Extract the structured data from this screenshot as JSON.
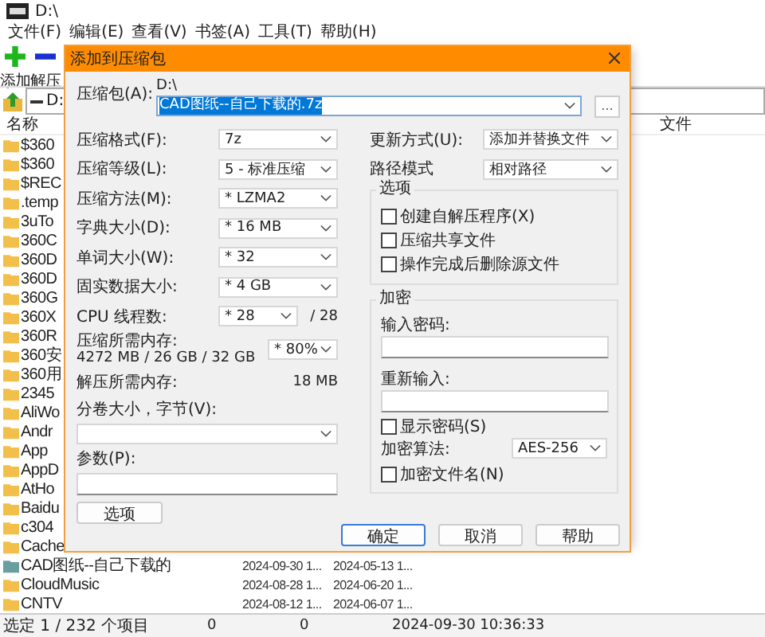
{
  "window": {
    "title": "D:\\"
  },
  "menu": [
    "文件(F)",
    "编辑(E)",
    "查看(V)",
    "书签(A)",
    "工具(T)",
    "帮助(H)"
  ],
  "toolbar": [
    {
      "kind": "add",
      "label": "添加"
    },
    {
      "kind": "extract",
      "label": "解压"
    }
  ],
  "address": {
    "value": "D:"
  },
  "file_list": {
    "columns": [
      "名称",
      "文件"
    ],
    "rows": [
      {
        "name": "$360",
        "color": "#f2c04a"
      },
      {
        "name": "$360",
        "color": "#f2c04a"
      },
      {
        "name": "$REC",
        "color": "#f2c04a"
      },
      {
        "name": ".temp",
        "color": "#f2c04a"
      },
      {
        "name": "3uTo",
        "color": "#f2c04a"
      },
      {
        "name": "360C",
        "color": "#f2c04a"
      },
      {
        "name": "360D",
        "color": "#f2c04a"
      },
      {
        "name": "360D",
        "color": "#f2c04a"
      },
      {
        "name": "360G",
        "color": "#f2c04a"
      },
      {
        "name": "360X",
        "color": "#f2c04a"
      },
      {
        "name": "360R",
        "color": "#f2c04a"
      },
      {
        "name": "360安",
        "color": "#f2c04a"
      },
      {
        "name": "360用",
        "color": "#f2c04a"
      },
      {
        "name": "2345",
        "color": "#f2c04a"
      },
      {
        "name": "AliWo",
        "color": "#f2c04a"
      },
      {
        "name": "Andr",
        "color": "#f2c04a"
      },
      {
        "name": "App",
        "color": "#f2c04a"
      },
      {
        "name": "AppD",
        "color": "#f2c04a"
      },
      {
        "name": "AtHo",
        "color": "#f2c04a"
      },
      {
        "name": "Baidu",
        "color": "#f2c04a"
      },
      {
        "name": "c304",
        "color": "#f2c04a"
      },
      {
        "name": "Cache",
        "color": "#f2c04a"
      },
      {
        "name": "CAD图纸--自己下载的",
        "color": "#6a9ea0",
        "modified": "2024-09-30 1...",
        "created": "2024-05-13 1..."
      },
      {
        "name": "CloudMusic",
        "color": "#f2c04a",
        "modified": "2024-08-28 1...",
        "created": "2024-06-20 1..."
      },
      {
        "name": "CNTV",
        "color": "#f2c04a",
        "modified": "2024-08-12 1...",
        "created": "2024-06-07 1..."
      }
    ]
  },
  "status_bar": [
    "选定 1 / 232 个项目",
    "0",
    "0",
    "2024-09-30 10:36:33"
  ],
  "dialog": {
    "title": "添加到压缩包",
    "archive": {
      "label": "压缩包(A):",
      "path": "D:\\",
      "value": "CAD图纸--自己下载的.7z",
      "browse": "..."
    },
    "left": [
      {
        "kind": "select",
        "label": "压缩格式(F):",
        "value": "7z"
      },
      {
        "kind": "select",
        "label": "压缩等级(L):",
        "value": "5 - 标准压缩"
      },
      {
        "kind": "select",
        "label": "压缩方法(M):",
        "value": "* LZMA2"
      },
      {
        "kind": "select",
        "label": "字典大小(D):",
        "value": "* 16 MB"
      },
      {
        "kind": "select",
        "label": "单词大小(W):",
        "value": "* 32"
      },
      {
        "kind": "select",
        "label": "固实数据大小:",
        "value": "* 4 GB"
      },
      {
        "kind": "select",
        "label": "CPU 线程数:",
        "value": "* 28",
        "suffix": "/ 28"
      },
      {
        "kind": "memory",
        "label": "压缩所需内存:",
        "detail": "4272 MB / 26 GB / 32 GB",
        "value": "* 80%"
      },
      {
        "kind": "info",
        "label": "解压所需内存:",
        "value": "18 MB"
      },
      {
        "kind": "select_below",
        "label": "分卷大小，字节(V):"
      },
      {
        "kind": "input_below",
        "label": "参数(P):"
      }
    ],
    "options_button": "选项",
    "right": [
      {
        "kind": "select",
        "label": "更新方式(U):",
        "value": "添加并替换文件"
      },
      {
        "kind": "select",
        "label": "路径模式",
        "value": "相对路径"
      }
    ],
    "options_group": {
      "title": "选项",
      "checkboxes": [
        {
          "label": "创建自解压程序(X)",
          "checked": false
        },
        {
          "label": "压缩共享文件",
          "checked": false
        },
        {
          "label": "操作完成后删除源文件",
          "checked": false
        }
      ]
    },
    "encryption": {
      "title": "加密",
      "password_label": "输入密码:",
      "repeat_label": "重新输入:",
      "show_password": {
        "label": "显示密码(S)",
        "checked": false
      },
      "method_label": "加密算法:",
      "method": "AES-256",
      "encrypt_names": {
        "label": "加密文件名(N)",
        "checked": false
      }
    },
    "buttons": [
      {
        "label": "确定",
        "focused": true
      },
      {
        "label": "取消",
        "focused": false
      },
      {
        "label": "帮助",
        "focused": false
      }
    ]
  }
}
